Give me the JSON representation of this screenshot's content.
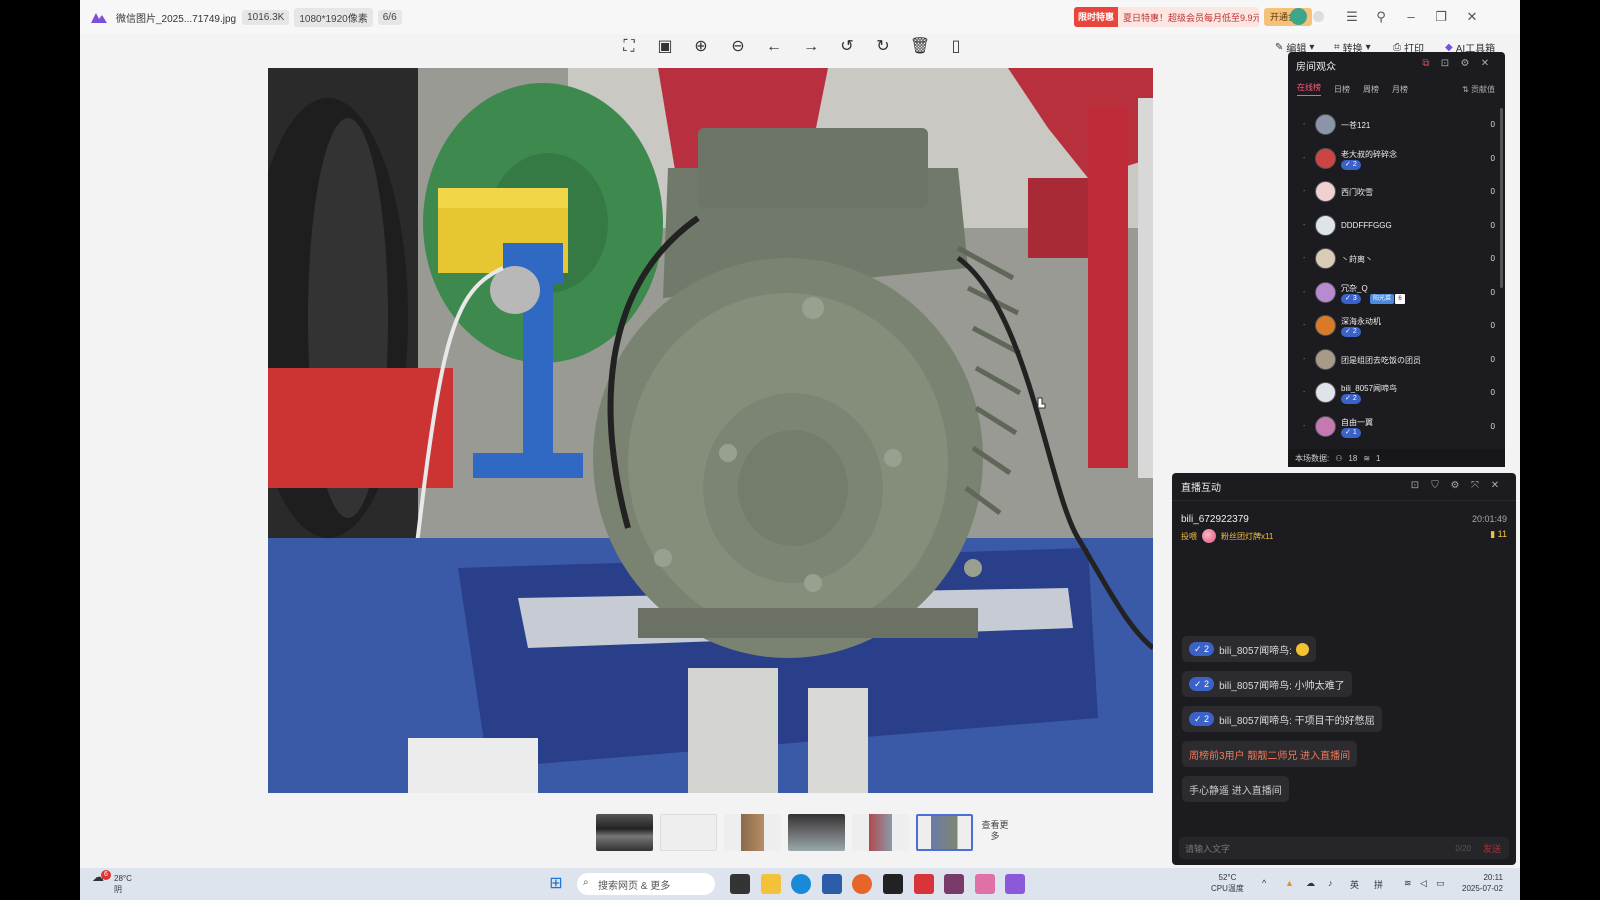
{
  "titlebar": {
    "title": "微信图片_2025...71749.jpg",
    "size": "1016.3K",
    "resolution": "1080*1920像素",
    "index": "6/6",
    "promo_tag": "限时特惠",
    "promo_text": "夏日特惠！超级会员每月低至9.9元",
    "vip_label": "开通会员"
  },
  "toolbar": {
    "edit_label": "编辑",
    "convert_label": "转换",
    "print_label": "打印",
    "ai_label": "AI工具箱"
  },
  "thumbnails": {
    "more_label": "查看更多"
  },
  "audience": {
    "title": "房间观众",
    "tabs": [
      "在线榜",
      "日榜",
      "周榜",
      "月榜"
    ],
    "contrib_label": "贡献值",
    "rows": [
      {
        "name": "一苍121",
        "level": "",
        "score": "0"
      },
      {
        "name": "老大叔的碎碎念",
        "level": "2",
        "score": "0"
      },
      {
        "name": "西门吹雪",
        "level": "",
        "score": "0"
      },
      {
        "name": "DDDFFFGGG",
        "level": "",
        "score": "0"
      },
      {
        "name": "丶莳离丶",
        "level": "",
        "score": "0"
      },
      {
        "name": "冗杂_Q",
        "level": "3",
        "fan": "阳光菜",
        "fan_level": "6",
        "score": "0"
      },
      {
        "name": "深海永动机",
        "level": "2",
        "score": "0"
      },
      {
        "name": "团是组团去吃饭の团员",
        "level": "",
        "score": "0"
      },
      {
        "name": "bili_8057闻啼鸟",
        "level": "2",
        "score": "0"
      },
      {
        "name": "自由一翼",
        "level": "1",
        "score": "0"
      }
    ],
    "footer_label": "本场数据:",
    "footer_viewers": "18",
    "footer_likes": "1"
  },
  "interaction": {
    "title": "直播互动",
    "gift_user": "bili_672922379",
    "gift_time": "20:01:49",
    "gift_action": "投喂",
    "gift_name": "粉丝团灯牌x11",
    "gift_count": "11",
    "messages": [
      {
        "level": "2",
        "text": "bili_8057闻啼鸟: "
      },
      {
        "level": "2",
        "text": "bili_8057闻啼鸟: 小帅太难了"
      },
      {
        "level": "2",
        "text": "bili_8057闻啼鸟: 干项目干的好憋屈"
      }
    ],
    "enter_msg_1": "周榜前3用户 靓靓二师兄 进入直播间",
    "enter_msg_2": "手心静遥 进入直播间",
    "input_placeholder": "请输入文字",
    "input_count": "0/20",
    "send_label": "发送"
  },
  "taskbar": {
    "weather_temp": "28°C",
    "weather_desc": "阴",
    "weather_badge": "6",
    "search_placeholder": "搜索网页 & 更多",
    "cpu_temp": "52°C",
    "cpu_label": "CPU温度",
    "ime_lang": "英",
    "ime_mode": "拼",
    "time": "20:11",
    "date": "2025-07-02"
  }
}
